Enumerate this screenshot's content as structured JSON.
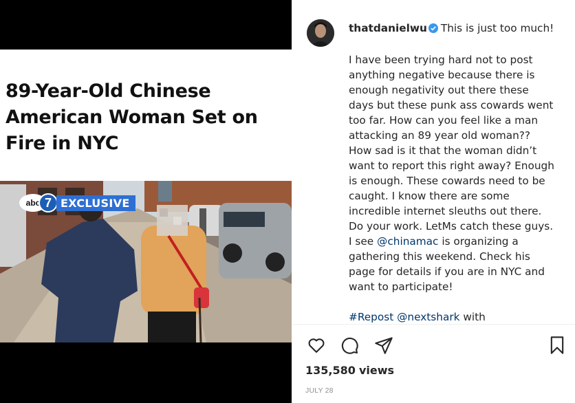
{
  "media": {
    "headline": "89-Year-Old Chinese American Woman Set on Fire in NYC",
    "badge": {
      "logo": "abc",
      "channel": "7",
      "label": "EXCLUSIVE"
    }
  },
  "post": {
    "username": "thatdanielwu",
    "verified_icon": "verified-badge-icon",
    "caption_first_line": "This is just too much!",
    "caption_body": "I have been trying hard not to post anything negative because there is enough negativity out there these days but these punk ass cowards went too far. How can you feel like a man attacking an 89 year old woman?? How sad is it that the woman didn’t want to report this right away? Enough is enough. These cowards need to be caught. I know there are some incredible internet sleuths out there. Do your work. LetMs catch these guys. I see",
    "mention_chinamac": "@chinamac",
    "caption_after_mention": "is organizing a gathering this weekend. Check his page for details if you are in NYC and want to participate!",
    "repost_hashtag": "#Repost",
    "repost_mention": "@nextshark",
    "repost_suffix": "with"
  },
  "actions": {
    "like_icon": "heart-icon",
    "comment_icon": "comment-icon",
    "share_icon": "share-icon",
    "save_icon": "bookmark-icon"
  },
  "stats": {
    "views": "135,580",
    "views_label": "views",
    "date": "JULY 28"
  },
  "colors": {
    "verified": "#3897f0",
    "link": "#00376b",
    "badge": "#2e6fd3"
  }
}
